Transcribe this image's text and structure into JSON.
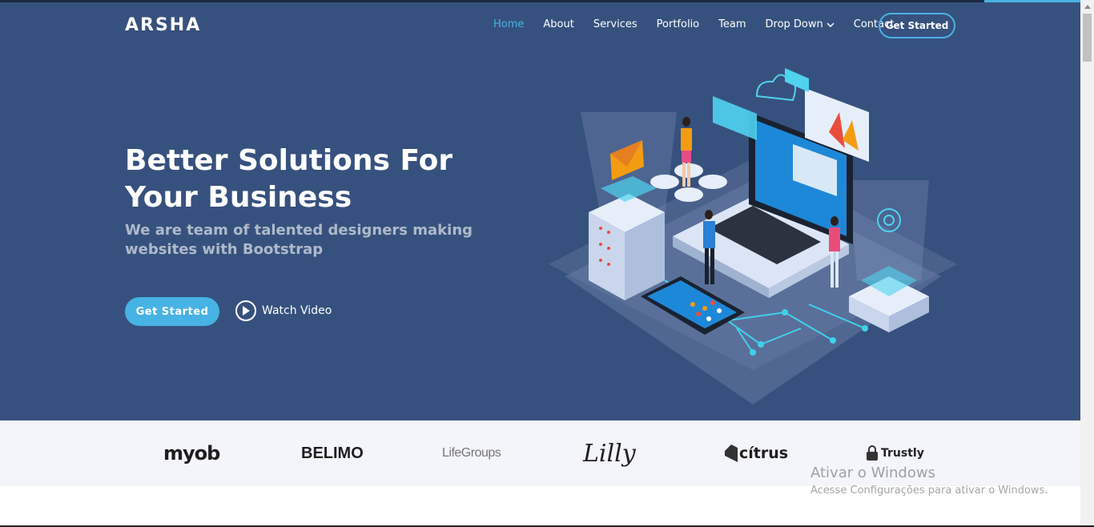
{
  "brand": {
    "logo": "ARSHA"
  },
  "nav": {
    "items": [
      {
        "label": "Home",
        "active": true
      },
      {
        "label": "About"
      },
      {
        "label": "Services"
      },
      {
        "label": "Portfolio"
      },
      {
        "label": "Team"
      },
      {
        "label": "Drop Down"
      },
      {
        "label": "Contact"
      }
    ],
    "cta": "Get Started"
  },
  "hero": {
    "title": "Better Solutions For Your Business",
    "subtitle": "We are team of talented designers making websites with Bootstrap",
    "primary_button": "Get Started",
    "video_link": "Watch Video"
  },
  "clients": [
    {
      "name": "myob"
    },
    {
      "name": "BELIMO"
    },
    {
      "name": "LifeGroups"
    },
    {
      "name": "Lilly"
    },
    {
      "name": "cítrus"
    },
    {
      "name": "Trustly"
    }
  ],
  "windows_watermark": {
    "title": "Ativar o Windows",
    "subtitle": "Acesse Configurações para ativar o Windows."
  },
  "colors": {
    "hero_bg": "#37517e",
    "accent": "#47b2e4",
    "clients_bg": "#f3f5fa"
  },
  "icons": [
    "chevron-down-icon",
    "play-icon",
    "lock-icon",
    "scroll-up-icon"
  ]
}
